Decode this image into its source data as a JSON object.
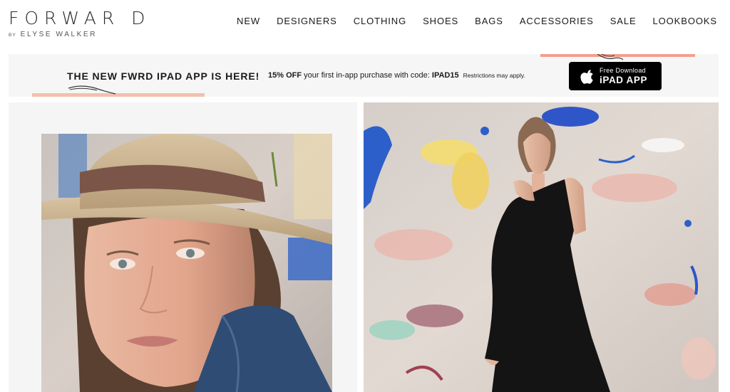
{
  "logo": {
    "main": "FORWAR D",
    "by": "BY",
    "sub": "ELYSE WALKER"
  },
  "nav": {
    "items": [
      {
        "id": "new",
        "label": "NEW"
      },
      {
        "id": "designers",
        "label": "DESIGNERS"
      },
      {
        "id": "clothing",
        "label": "CLOTHING"
      },
      {
        "id": "shoes",
        "label": "SHOES"
      },
      {
        "id": "bags",
        "label": "BAGS"
      },
      {
        "id": "accessories",
        "label": "ACCESSORIES"
      },
      {
        "id": "sale",
        "label": "SALE"
      },
      {
        "id": "lookbooks",
        "label": "LOOKBOOKS"
      }
    ]
  },
  "banner": {
    "headline": "THE NEW FWRD IPAD APP IS HERE!",
    "offer_bold": "15% OFF",
    "offer_text": "your first in-app purchase with code:",
    "offer_code": "IPAD15",
    "restrictions": "Restrictions may apply.",
    "app_button": {
      "small": "Free Download",
      "big": "iPAD APP",
      "icon": "apple-icon"
    }
  },
  "hero": {
    "left_image": "model-portrait-with-hat",
    "right_image": "model-in-black-one-shoulder-dress"
  },
  "colors": {
    "accent_pink": "#f0a08c",
    "banner_bg": "#f6f6f6",
    "button_bg": "#000000"
  }
}
